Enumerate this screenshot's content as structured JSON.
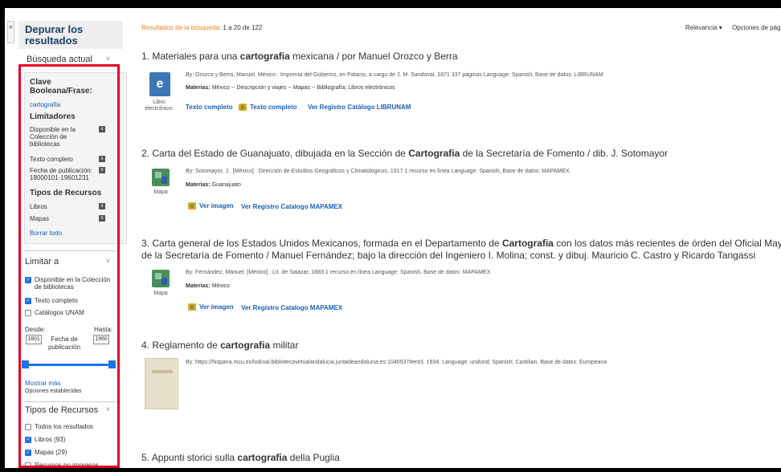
{
  "sidebar": {
    "collapse_glyph": "«",
    "refine_title": "Depurar los resultados",
    "current_search_title": "Búsqueda actual",
    "current": {
      "keyword_label": "Clave Booleana/Frase:",
      "keyword_value": "cartografía",
      "limiters_label": "Limitadores",
      "limiters": [
        "Disponible en la Colección de bibliotecas",
        "Texto completo",
        "Fecha de publicación: 18000101-19601231"
      ],
      "types_label": "Tipos de Recursos",
      "types": [
        "Libros",
        "Mapas"
      ],
      "clear_all": "Borrar todo",
      "remove_glyph": "x"
    },
    "limit_title": "Limitar a",
    "limit_options": [
      {
        "label": "Disponible en la Colección de bibliotecas",
        "checked": true
      },
      {
        "label": "Texto completo",
        "checked": true
      },
      {
        "label": "Catálogos UNAM",
        "checked": false
      }
    ],
    "date": {
      "from_label": "Desde:",
      "to_label": "Hasta:",
      "from_value": "1801",
      "to_value": "1960",
      "field_label": "Fecha de publicación"
    },
    "show_more": "Mostrar más",
    "set_options": "Opciones establecidas",
    "types_title": "Tipos de Recursos",
    "type_options": [
      {
        "label": "Todos los resultados",
        "checked": false
      },
      {
        "label": "Libros (93)",
        "checked": true
      },
      {
        "label": "Mapas (29)",
        "checked": true
      },
      {
        "label": "Recursos no impresos",
        "checked": false
      }
    ],
    "chevron": "˅"
  },
  "results": {
    "label": "Resultados de la búsqueda:",
    "range": "1 a 20 de 122",
    "sort_label": "Relevancia ▾",
    "options_label": "Opciones de pág"
  },
  "records": [
    {
      "num": "1.",
      "title_pre": "Materiales para una ",
      "title_bold": "cartografia",
      "title_post": " mexicana / por Manuel Orozco y Berra",
      "by": "By: Orozco y Berra, Manuel. México : Imprenta del Gobierno, en Palacio, a cargo de J. M. Sandoval, 1871 337 páginas Language: Spanish, Base de datos: LIBRUNAM",
      "subjects_label": "Materias:",
      "subjects": "México -- Descripción y viajes -- Mapas -- Bibliografía; Libros electrónicos",
      "format": "Libro electrónico:",
      "link1": "Texto completo",
      "link2": "Texto completo",
      "link3": "Ver Registro Catálogo LIBRUNAM"
    },
    {
      "num": "2.",
      "title_pre": "Carta del Estado de Guanajuato, dibujada en la Sección de ",
      "title_bold": "Cartografia",
      "title_post": " de la Secretaría de Fomento / dib. J. Sotomayor",
      "by": "By: Sotomayor, J.. [México] : Dirección de Estudios Geográficos y Climatológicos, 1917 1 recurso en línea Language: Spanish, Base de datos: MAPAMEX",
      "subjects_label": "Materias:",
      "subjects": "Guanajuato",
      "format": "Mapa",
      "link1": "Ver imagen",
      "link2": "Ver Registro Catalogo MAPAMEX"
    },
    {
      "num": "3.",
      "title_pre": "Carta general de los Estados Unidos Mexicanos, formada en el Departamento de ",
      "title_bold": "Cartografia",
      "title_post": " con los datos más recientes de órden del Oficial May",
      "title_line2": "de la Secretaría de Fomento / Manuel Fernández; bajo la dirección del Ingeniero I. Molina; const. y dibuj. Mauricio C. Castro y Ricardo Tangassi",
      "by": "By: Fernández, Manuel. [México] : Lit. de Salazar, 1883 1 recurso en línea Language: Spanish, Base de datos: MAPAMEX",
      "subjects_label": "Materias:",
      "subjects": "México",
      "format": "Mapa",
      "link1": "Ver imagen",
      "link2": "Ver Registro Catalogo MAPAMEX"
    },
    {
      "num": "4.",
      "title_pre": "Reglamento de ",
      "title_bold": "cartografia",
      "title_post": " militar",
      "by": "By: https://hispana.mcu.es/lod/oai:bibliotecavirtualandalucia.juntadeandalucia.es:1040537#ent3. 1934. Language: undund; Spanish; Castilian, Base de datos: Europeana"
    },
    {
      "num": "5.",
      "title_pre": "Appunti storici sulla ",
      "title_bold": "cartografia",
      "title_post": " della Puglia"
    }
  ]
}
